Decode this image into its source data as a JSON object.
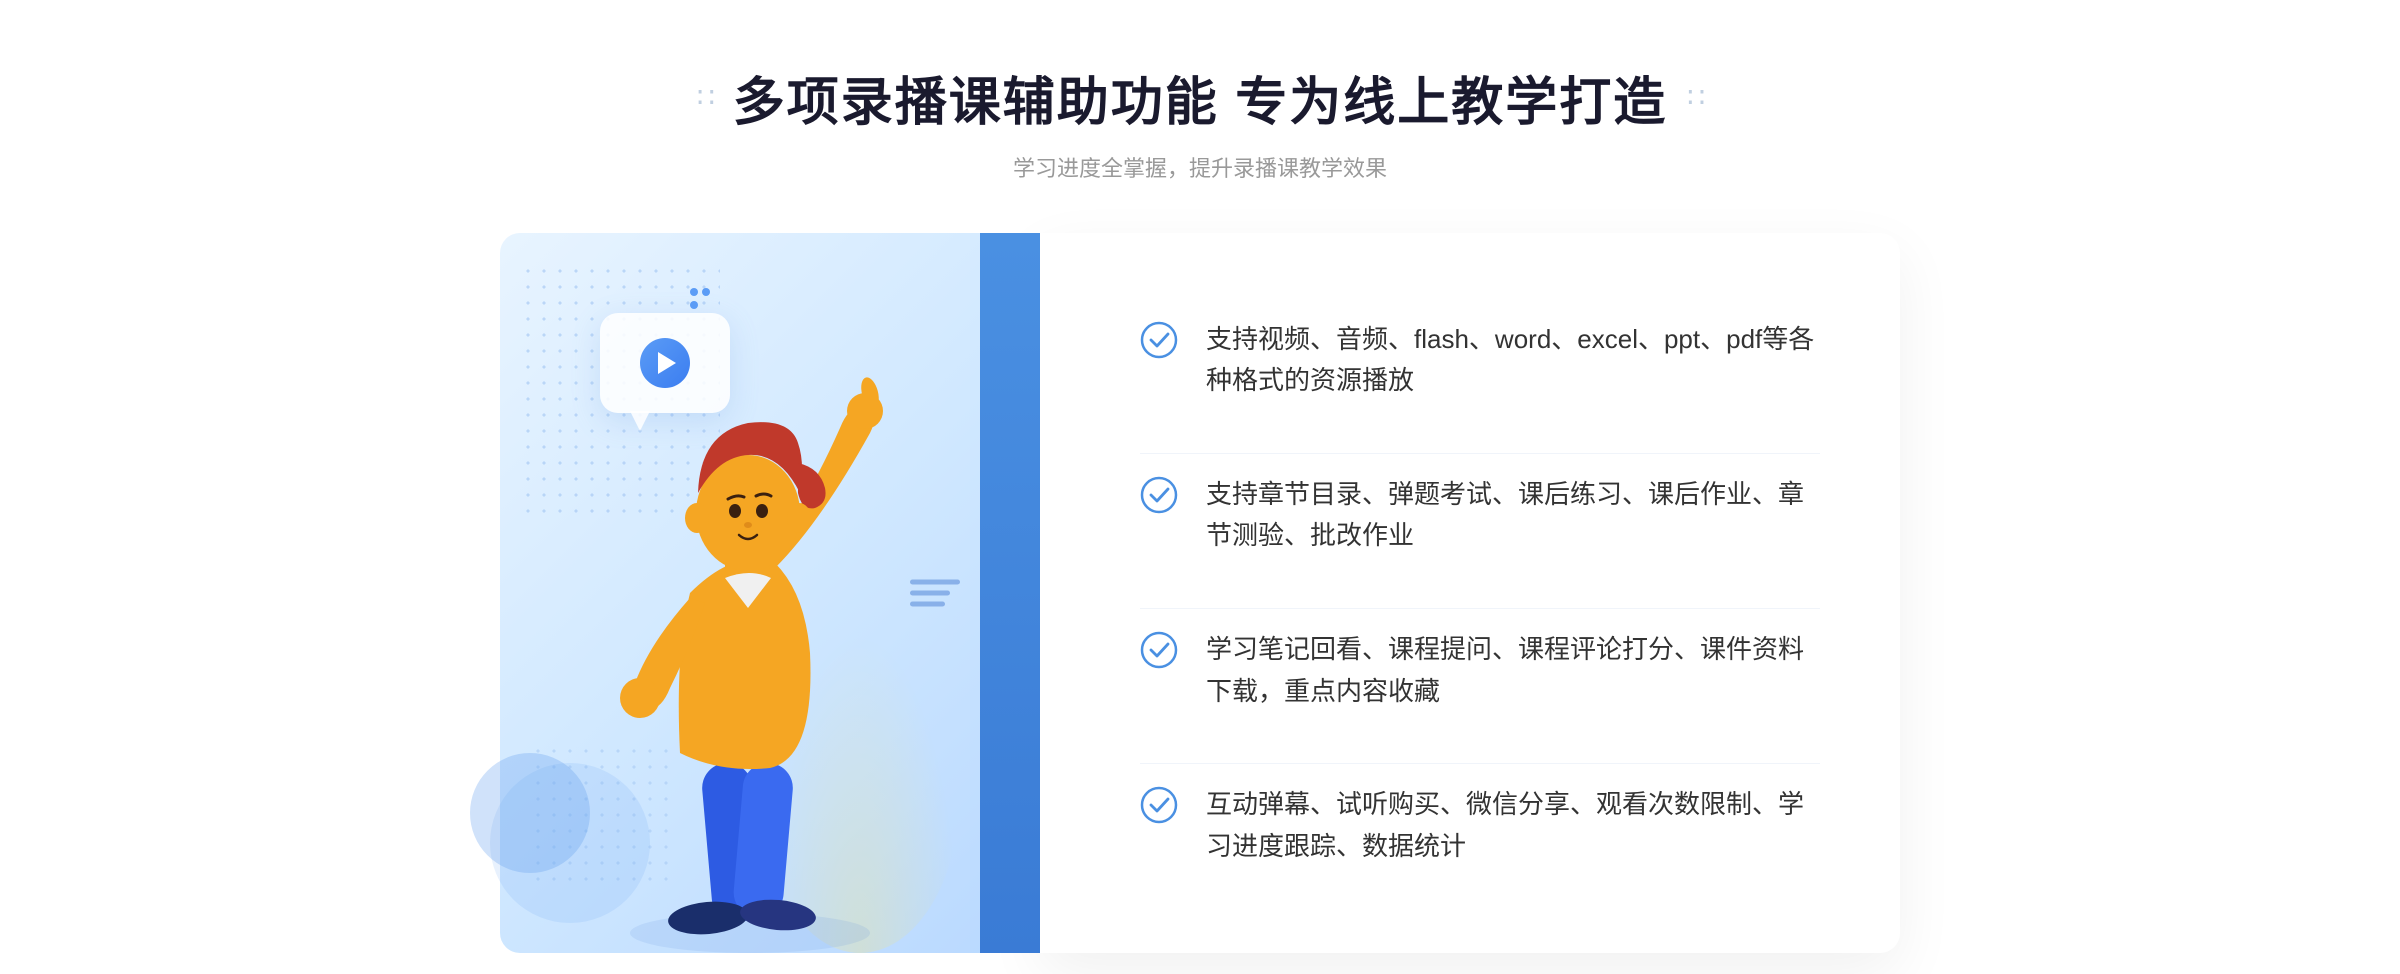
{
  "header": {
    "title": "多项录播课辅助功能 专为线上教学打造",
    "subtitle": "学习进度全掌握，提升录播课教学效果",
    "decoration_left": "∷",
    "decoration_right": "∷"
  },
  "features": [
    {
      "id": 1,
      "text": "支持视频、音频、flash、word、excel、ppt、pdf等各种格式的资源播放"
    },
    {
      "id": 2,
      "text": "支持章节目录、弹题考试、课后练习、课后作业、章节测验、批改作业"
    },
    {
      "id": 3,
      "text": "学习笔记回看、课程提问、课程评论打分、课件资料下载，重点内容收藏"
    },
    {
      "id": 4,
      "text": "互动弹幕、试听购买、微信分享、观看次数限制、学习进度跟踪、数据统计"
    }
  ],
  "arrows": {
    "left": "»"
  },
  "colors": {
    "primary": "#4a90e2",
    "text_dark": "#1a1a2e",
    "text_gray": "#999999",
    "text_body": "#333333",
    "check_color": "#4a90e2"
  }
}
